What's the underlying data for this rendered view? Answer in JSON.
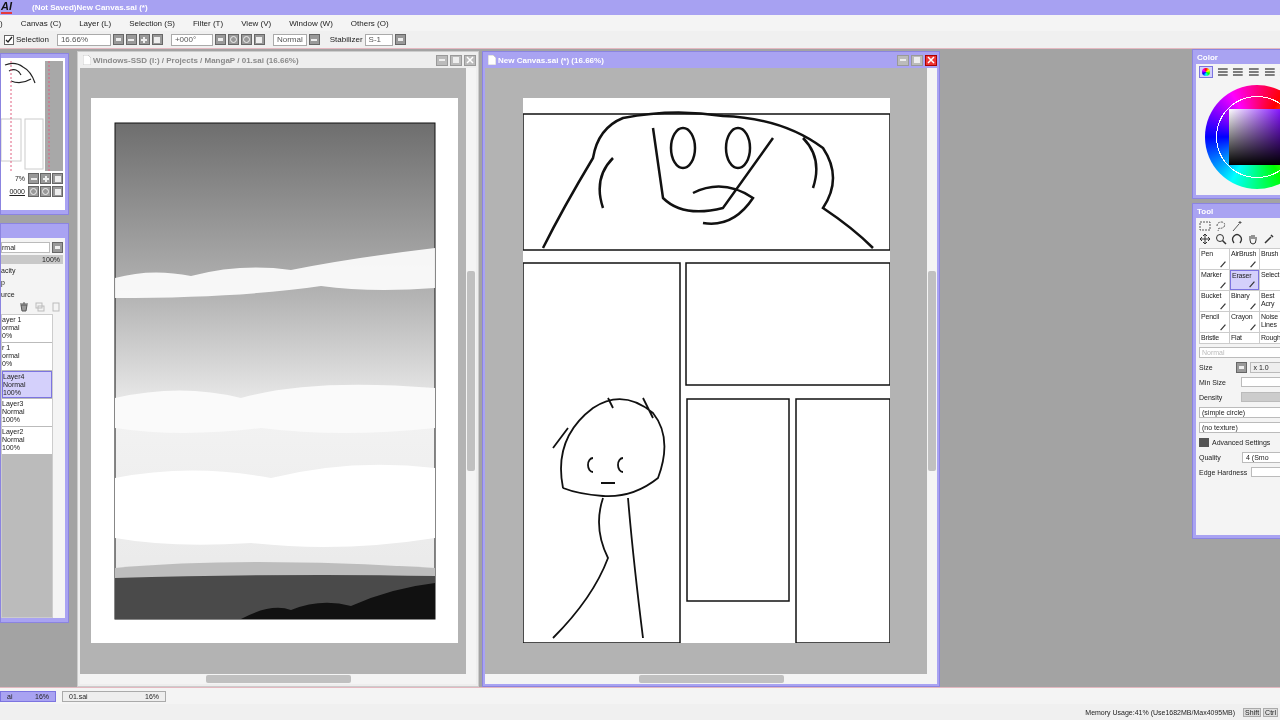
{
  "app": {
    "logo": "AI",
    "title": "(Not Saved)New Canvas.sai (*)"
  },
  "menu": [
    ")",
    "Canvas (C)",
    "Layer (L)",
    "Selection (S)",
    "Filter (T)",
    "View (V)",
    "Window (W)",
    "Others (O)"
  ],
  "toolbar": {
    "selection": {
      "label": "Selection",
      "checked": true
    },
    "zoom": "16.66%",
    "angle": "+000°",
    "mode": "Normal",
    "stabilizer_label": "Stabilizer",
    "stabilizer": "S-1"
  },
  "navigator": {
    "zoom": "7%",
    "angle": "0000"
  },
  "layers_panel": {
    "blend_mode": "rmal",
    "opacity": "100%",
    "opacity_slider": {
      "level": 1
    },
    "options": [
      "acity",
      "p",
      "urce"
    ],
    "layers": [
      {
        "name": "ayer 1",
        "mode": "ormal",
        "opacity": "0%",
        "selected": false
      },
      {
        "name": "r 1",
        "mode": "ormal",
        "opacity": "0%",
        "selected": false
      },
      {
        "name": "Layer4",
        "mode": "Normal",
        "opacity": "100%",
        "selected": true
      },
      {
        "name": "Layer3",
        "mode": "Normal",
        "opacity": "100%",
        "selected": false
      },
      {
        "name": "Layer2",
        "mode": "Normal",
        "opacity": "100%",
        "selected": false
      }
    ]
  },
  "windows": [
    {
      "title": "Windows-SSD (I:) / Projects / MangaP / 01.sai (16.66%)",
      "active": false,
      "kind": "landscape"
    },
    {
      "title": "New Canvas.sai (*) (16.66%)",
      "active": true,
      "kind": "manga"
    }
  ],
  "color_panel": {
    "title": "Color"
  },
  "tool_panel": {
    "title": "Tool",
    "brushes": [
      {
        "label": "Pen",
        "selected": false
      },
      {
        "label": "AirBrush",
        "selected": false
      },
      {
        "label": "Brush",
        "selected": false
      },
      {
        "label": "Marker",
        "selected": false
      },
      {
        "label": "Eraser",
        "selected": true
      },
      {
        "label": "Select",
        "selected": false
      },
      {
        "label": "Bucket",
        "selected": false
      },
      {
        "label": "Binary",
        "selected": false
      },
      {
        "label": "Best",
        "sub": "Acry",
        "selected": false
      },
      {
        "label": "Pencil",
        "selected": false
      },
      {
        "label": "Crayon",
        "selected": false
      },
      {
        "label": "Noise",
        "sub": "Lines",
        "selected": false
      },
      {
        "label": "Bristle",
        "selected": false
      },
      {
        "label": "Flat",
        "selected": false
      },
      {
        "label": "Rough",
        "selected": false
      }
    ],
    "mode": "Normal",
    "size_label": "Size",
    "size": "x 1.0",
    "min_size_label": "Min Size",
    "min_size_slider": {
      "level": 0
    },
    "density_label": "Density",
    "density_slider": {
      "level": 1
    },
    "shape": "(simple circle)",
    "texture": "(no texture)",
    "advanced": {
      "label": "Advanced Settings",
      "expanded": true
    },
    "quality_label": "Quality",
    "quality": "4 (Smo",
    "edge_label": "Edge Hardness",
    "edge_slider": {
      "level": 0
    }
  },
  "tabs": [
    {
      "name": "ai",
      "zoom": "16%",
      "selected": true
    },
    {
      "name": "01.sai",
      "zoom": "16%",
      "selected": false
    }
  ],
  "status": {
    "memory": "Memory Usage:41% (Use1682MB/Max4095MB)",
    "keys": [
      "Shift",
      "Ctrl"
    ]
  }
}
